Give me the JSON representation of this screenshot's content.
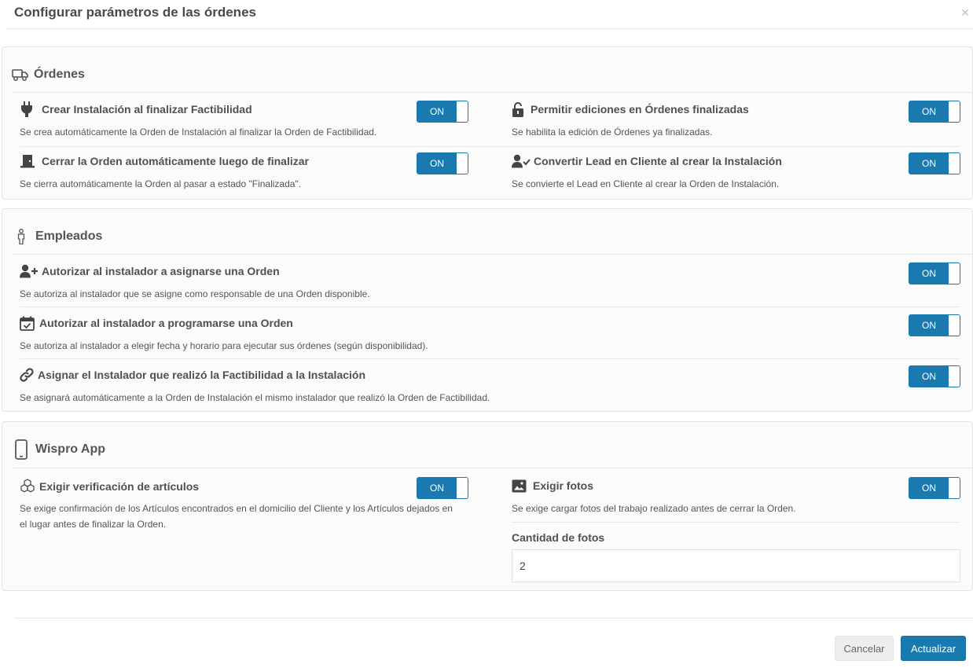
{
  "modal": {
    "title": "Configurar parámetros de las órdenes",
    "close_symbol": "×"
  },
  "sections": {
    "ordenes": {
      "title": "Órdenes",
      "icon": "truck-icon",
      "settings": {
        "instalacion": {
          "title": "Crear Instalación al finalizar Factibilidad",
          "description": "Se crea automáticamente la Orden de Instalación al finalizar la Orden de Factibilidad.",
          "toggle": "ON",
          "icon": "plug-icon"
        },
        "ediciones": {
          "title": "Permitir ediciones en Órdenes finalizadas",
          "description": "Se habilita la edición de Órdenes ya finalizadas.",
          "toggle": "ON",
          "icon": "unlock-icon"
        },
        "cerrar": {
          "title": "Cerrar la Orden automáticamente luego de finalizar",
          "description": "Se cierra automáticamente la Orden al pasar a estado \"Finalizada\".",
          "toggle": "ON",
          "icon": "door-closed-icon"
        },
        "lead": {
          "title": "Convertir Lead en Cliente al crear la Instalación",
          "description": "Se convierte el Lead en Cliente al crear la Orden de Instalación.",
          "toggle": "ON",
          "icon": "user-check-icon"
        }
      }
    },
    "empleados": {
      "title": "Empleados",
      "icon": "person-icon",
      "settings": {
        "asignarse": {
          "title": "Autorizar al instalador a asignarse una Orden",
          "description": "Se autoriza al instalador que se asigne como responsable de una Orden disponible.",
          "toggle": "ON",
          "icon": "user-plus-icon"
        },
        "programarse": {
          "title": "Autorizar al instalador a programarse una Orden",
          "description": "Se autoriza al instalador a elegir fecha y horario para ejecutar sus órdenes (según disponibilidad).",
          "toggle": "ON",
          "icon": "calendar-check-icon"
        },
        "factibilidad": {
          "title": "Asignar el Instalador que realizó la Factibilidad a la Instalación",
          "description": "Se asignará automáticamente a la Orden de Instalación el mismo instalador que realizó la Orden de Factibilidad.",
          "toggle": "ON",
          "icon": "link-icon"
        }
      }
    },
    "app": {
      "title": "Wispro App",
      "icon": "mobile-icon",
      "settings": {
        "articulos": {
          "title": "Exigir verificación de artículos",
          "description_line1": "Se exige confirmación de los Artículos encontrados en el domicilio del Cliente y los Artículos dejados en",
          "description_line2": "el lugar antes de finalizar la Orden.",
          "toggle": "ON",
          "icon": "cubes-icon"
        },
        "fotos": {
          "title": "Exigir fotos",
          "description": "Se exige cargar fotos del trabajo realizado antes de cerrar la Orden.",
          "toggle": "ON",
          "icon": "image-icon"
        }
      },
      "photo_count": {
        "label": "Cantidad de fotos",
        "value": "2"
      }
    }
  },
  "footer": {
    "cancel_label": "Cancelar",
    "update_label": "Actualizar"
  }
}
